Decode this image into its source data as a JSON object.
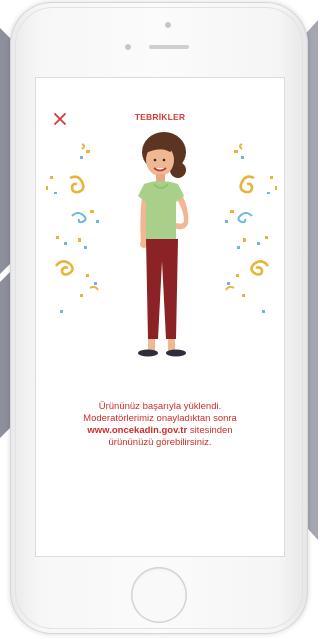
{
  "modal": {
    "title": "TEBRİKLER",
    "close_icon": "close-icon",
    "message_line1": "Ürününüz başarıyla yüklendi.",
    "message_line2": "Moderatörlerimiz onayladıktan sonra",
    "link_text": "www.oncekadin.gov.tr",
    "message_line3_rest": "sitesinden",
    "message_line4": "ürününüzü görebilirsiniz."
  },
  "colors": {
    "accent_red": "#d93a36",
    "background_chevron": "#8d8f9d",
    "shirt_green": "#a8d08a",
    "pants_maroon": "#8b2226",
    "confetti_gold": "#e7b53a",
    "confetti_blue": "#6fb7d6"
  },
  "icons": {
    "woman": "woman-illustration",
    "confetti": "confetti-icon",
    "home": "home-button"
  }
}
